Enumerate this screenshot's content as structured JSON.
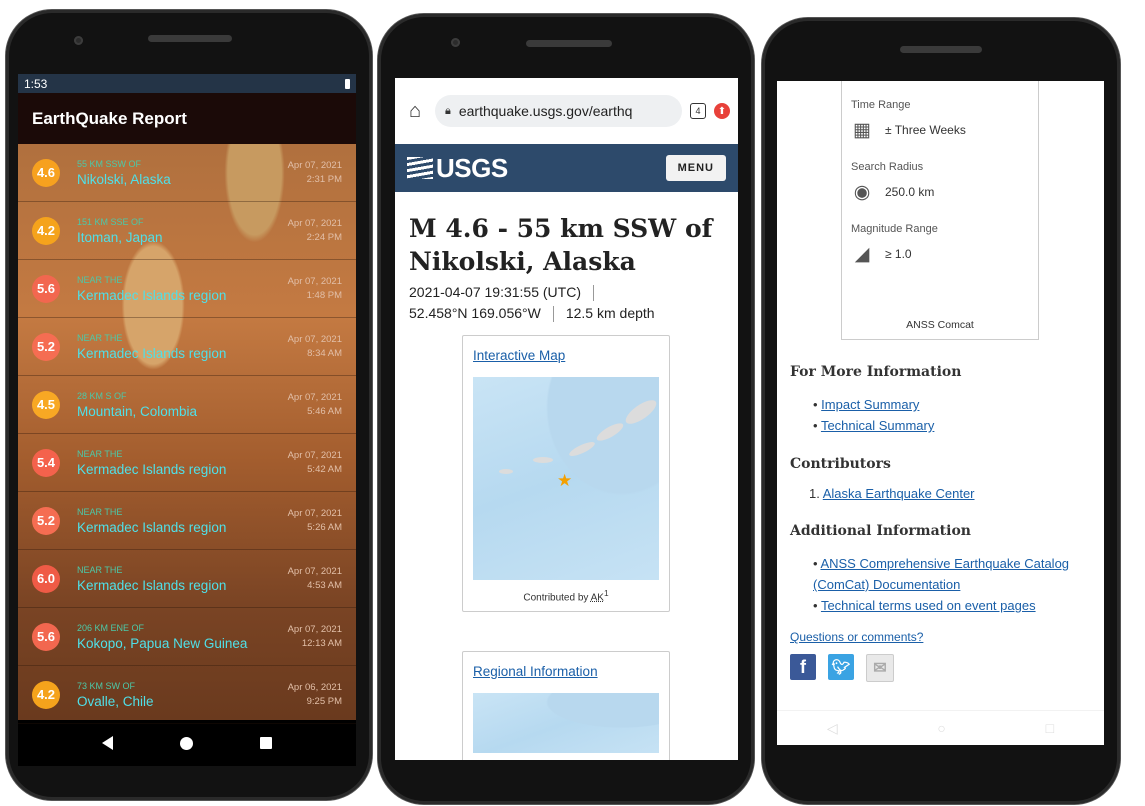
{
  "phone1": {
    "status_time": "1:53",
    "app_title": "EarthQuake Report",
    "mag_colors": {
      "4.6": "#f7a11f",
      "4.2": "#f5a31c",
      "4.5": "#f8a824",
      "5.2": "#f56d52",
      "5.4": "#f4624c",
      "5.6": "#f2674f",
      "6.0": "#ef5b46"
    },
    "earthquakes": [
      {
        "mag": "4.6",
        "offset": "55 KM SSW OF",
        "place": "Nikolski, Alaska",
        "date": "Apr 07, 2021",
        "time": "2:31 PM"
      },
      {
        "mag": "4.2",
        "offset": "151 KM SSE OF",
        "place": "Itoman, Japan",
        "date": "Apr 07, 2021",
        "time": "2:24 PM"
      },
      {
        "mag": "5.6",
        "offset": "NEAR THE",
        "place": "Kermadec Islands region",
        "date": "Apr 07, 2021",
        "time": "1:48 PM"
      },
      {
        "mag": "5.2",
        "offset": "NEAR THE",
        "place": "Kermadec Islands region",
        "date": "Apr 07, 2021",
        "time": "8:34 AM"
      },
      {
        "mag": "4.5",
        "offset": "28 KM S OF",
        "place": "Mountain, Colombia",
        "date": "Apr 07, 2021",
        "time": "5:46 AM"
      },
      {
        "mag": "5.4",
        "offset": "NEAR THE",
        "place": "Kermadec Islands region",
        "date": "Apr 07, 2021",
        "time": "5:42 AM"
      },
      {
        "mag": "5.2",
        "offset": "NEAR THE",
        "place": "Kermadec Islands region",
        "date": "Apr 07, 2021",
        "time": "5:26 AM"
      },
      {
        "mag": "6.0",
        "offset": "NEAR THE",
        "place": "Kermadec Islands region",
        "date": "Apr 07, 2021",
        "time": "4:53 AM"
      },
      {
        "mag": "5.6",
        "offset": "206 KM ENE OF",
        "place": "Kokopo, Papua New Guinea",
        "date": "Apr 07, 2021",
        "time": "12:13 AM"
      },
      {
        "mag": "4.2",
        "offset": "73 KM SW OF",
        "place": "Ovalle, Chile",
        "date": "Apr 06, 2021",
        "time": "9:25 PM"
      }
    ]
  },
  "phone2": {
    "url": "earthquake.usgs.gov/earthq",
    "tab_count": "4",
    "logo": "USGS",
    "menu_label": "MENU",
    "title": "M 4.6 - 55 km SSW of Nikolski, Alaska",
    "datetime": "2021-04-07 19:31:55 (UTC)",
    "coords": "52.458°N 169.056°W",
    "depth": "12.5 km depth",
    "interactive_map_link": "Interactive Map",
    "contributed_prefix": "Contributed by",
    "contributor_abbr": "AK",
    "contributor_sup": "1",
    "regional_link": "Regional Information"
  },
  "phone3": {
    "time_range_label": "Time Range",
    "time_range_value": "± Three Weeks",
    "search_radius_label": "Search Radius",
    "search_radius_value": "250.0 km",
    "magnitude_label": "Magnitude Range",
    "magnitude_value": "≥ 1.0",
    "source": "ANSS Comcat",
    "more_info_heading": "For More Information",
    "more_info_links": [
      "Impact Summary",
      "Technical Summary"
    ],
    "contributors_heading": "Contributors",
    "contributor_link": "Alaska Earthquake Center",
    "additional_heading": "Additional Information",
    "additional_links": [
      "ANSS Comprehensive Earthquake Catalog (ComCat) Documentation",
      "Technical terms used on event pages"
    ],
    "questions_link": "Questions or comments?"
  }
}
